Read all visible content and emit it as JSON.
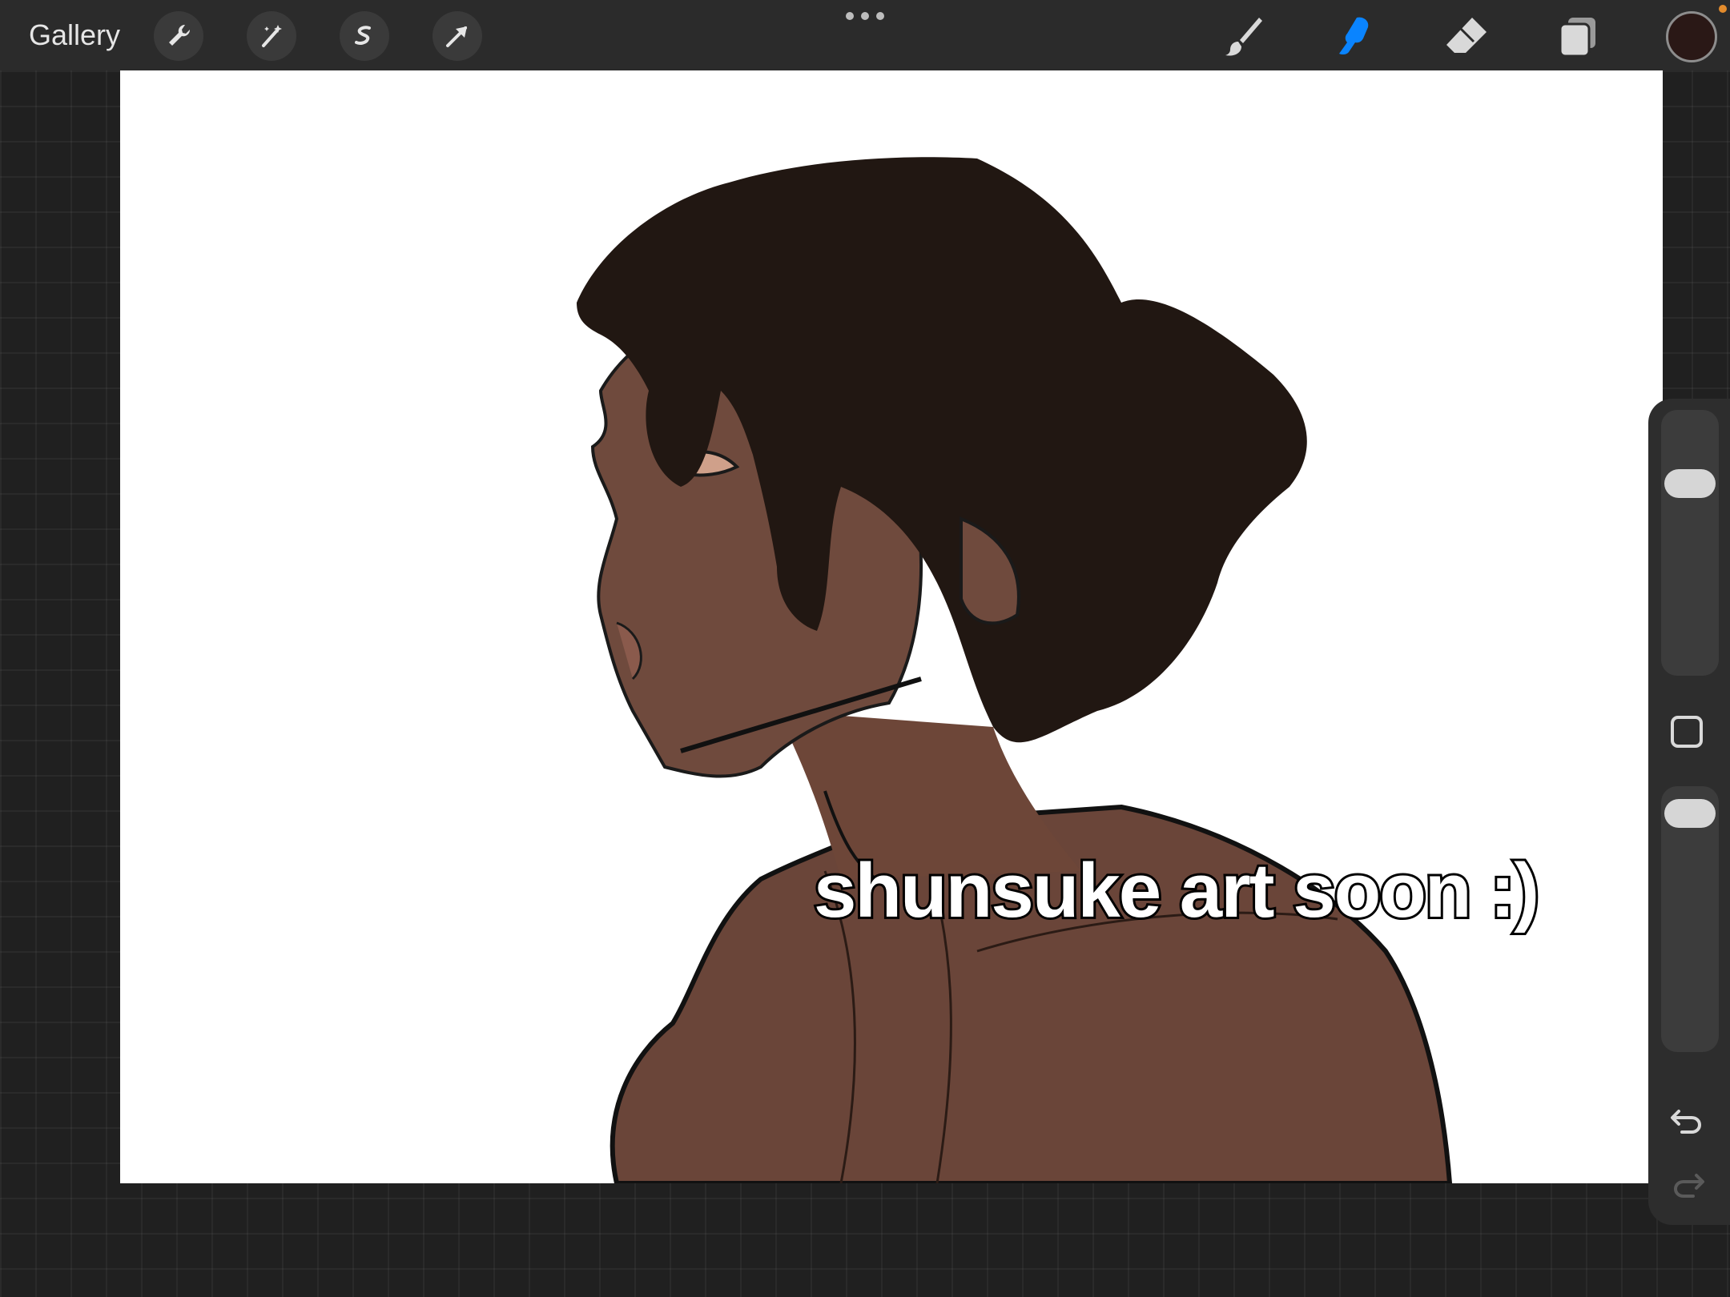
{
  "toolbar": {
    "gallery_label": "Gallery",
    "left_tools": [
      "wrench-icon",
      "magic-wand-icon",
      "selection-icon",
      "transform-arrow-icon"
    ],
    "right_tools": [
      "brush-icon",
      "smudge-icon",
      "eraser-icon",
      "layers-icon"
    ],
    "active_tool": "smudge",
    "accent_color": "#0a84ff",
    "current_color": "#2a1816"
  },
  "canvas": {
    "caption": "shunsuke art soon :)"
  },
  "side_panel": {
    "brush_size_level": 0.15,
    "opacity_level": 0.05,
    "undo_icon": "undo-arrow-icon",
    "redo_icon": "redo-arrow-icon"
  }
}
